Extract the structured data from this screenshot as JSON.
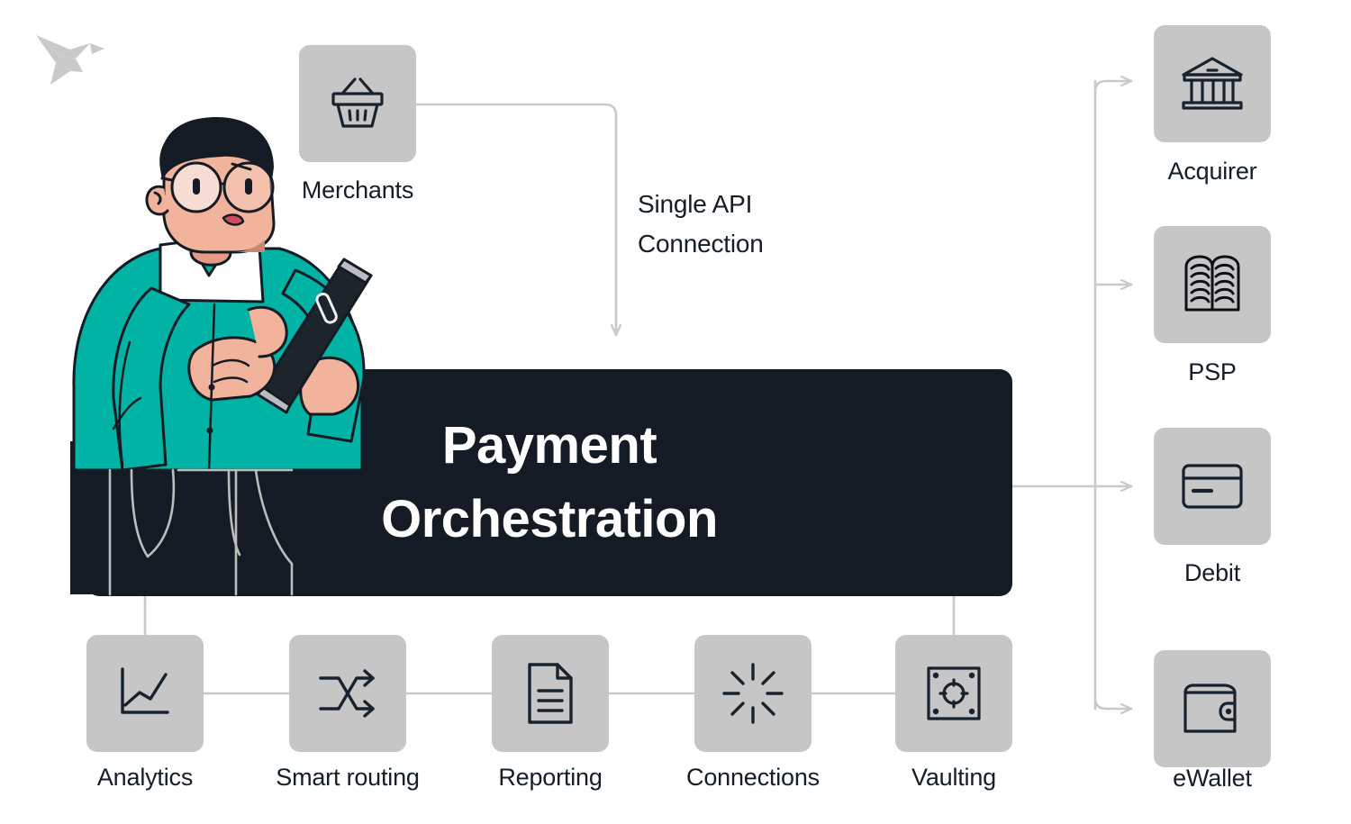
{
  "diagram": {
    "title": "Payment Orchestration diagram",
    "background_color": "#ffffff",
    "core": {
      "line1": "Payment",
      "line2": "Orchestration",
      "bg_color": "#141b24",
      "text_color": "#ffffff"
    },
    "annotation": {
      "line1": "Single API",
      "line2": "Connection"
    },
    "logo": {
      "name": "origami-bird-logo",
      "color": "#c9c9c9"
    },
    "illustration": {
      "name": "person-with-tablet",
      "skin_color": "#f2b39c",
      "sweater_color": "#00b3a4",
      "hair_color": "#141b24",
      "trousers_color": "#141b24",
      "shirt_color": "#ffffff",
      "tablet_color": "#1d242c"
    },
    "input_node": {
      "label": "Merchants",
      "icon": "shopping-basket-icon"
    },
    "feature_nodes": [
      {
        "label": "Analytics",
        "icon": "line-chart-icon"
      },
      {
        "label": "Smart routing",
        "icon": "shuffle-arrows-icon"
      },
      {
        "label": "Reporting",
        "icon": "document-lines-icon"
      },
      {
        "label": "Connections",
        "icon": "radial-burst-icon"
      },
      {
        "label": "Vaulting",
        "icon": "vault-door-icon"
      }
    ],
    "output_nodes": [
      {
        "label": "Acquirer",
        "icon": "bank-building-icon"
      },
      {
        "label": "PSP",
        "icon": "open-book-icon"
      },
      {
        "label": "Debit",
        "icon": "credit-card-icon"
      },
      {
        "label": "eWallet",
        "icon": "wallet-icon"
      }
    ],
    "colors": {
      "tile_bg": "#c6c6c6",
      "icon_stroke": "#18222c",
      "connector": "#c9c9c9",
      "accent": "#00b3a4"
    }
  }
}
